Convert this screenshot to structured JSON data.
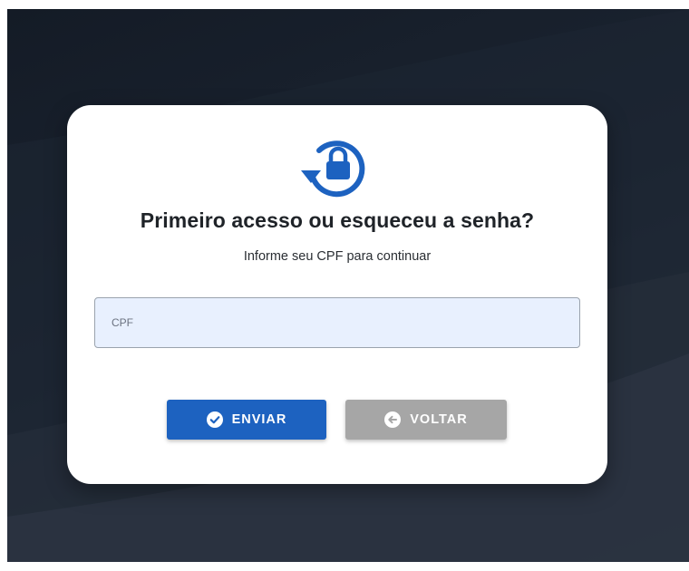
{
  "dialog": {
    "title": "Primeiro acesso ou esqueceu a senha?",
    "subtitle": "Informe seu CPF para continuar"
  },
  "cpf_field": {
    "placeholder": "CPF",
    "value": ""
  },
  "buttons": {
    "send_label": "ENVIAR",
    "back_label": "VOLTAR"
  },
  "icons": {
    "header": "lock-reset-icon",
    "send": "check-circle-icon",
    "back": "arrow-left-circle-icon"
  },
  "colors": {
    "primary": "#1d62c0",
    "secondary_button": "#a6a6a6",
    "input_background": "#e8f0fe",
    "card_background": "#ffffff"
  }
}
